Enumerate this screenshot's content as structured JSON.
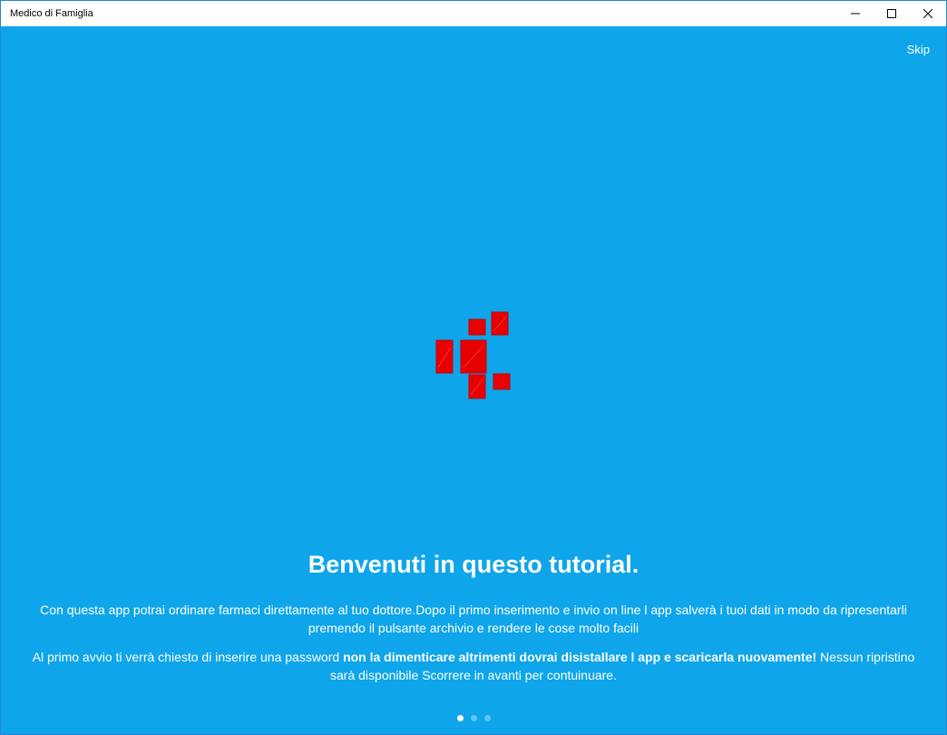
{
  "window": {
    "title": "Medico di Famiglia"
  },
  "header": {
    "skip_label": "Skip"
  },
  "tutorial": {
    "headline": "Benvenuti in questo tutorial.",
    "paragraph1_line1": "Con questa app potrai ordinare farmaci direttamente al tuo dottore.Dopo il primo inserimento e invio on line l app salverà i tuoi dati in modo da ripresentarli",
    "paragraph1_line2": "premendo il pulsante archivio e rendere le cose molto facili",
    "paragraph2_before": "Al primo avvio ti verrà chiesto di inserire una password ",
    "paragraph2_bold": "non la dimenticare altrimenti dovrai disistallare l app e scaricarla nuovamente",
    "paragraph2_after_bold": "!",
    "paragraph2_after": " Nessun ripristino sarà disponibile Scorrere in avanti per contuinuare."
  },
  "pager": {
    "pages": 3,
    "current": 1
  },
  "colors": {
    "background": "#0ea5eb",
    "logo_red": "#e80000",
    "text": "#ffffff"
  },
  "icons": {
    "logo": "red-squares-logo",
    "minimize": "minimize-icon",
    "maximize": "maximize-icon",
    "close": "close-icon"
  }
}
